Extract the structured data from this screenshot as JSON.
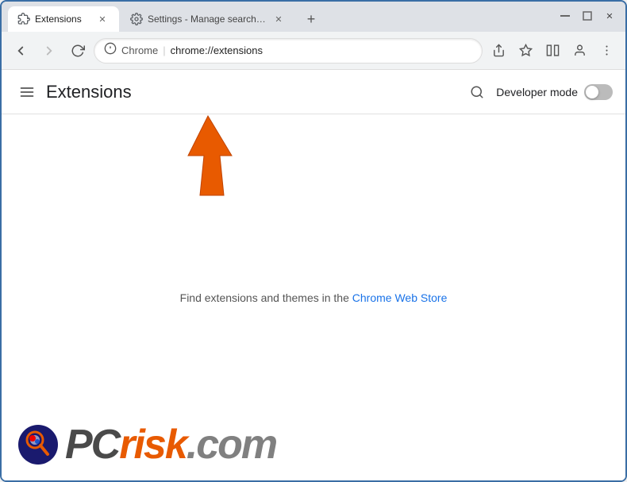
{
  "browser": {
    "tabs": [
      {
        "id": "tab-extensions",
        "label": "Extensions",
        "url": "chrome://extensions",
        "favicon": "puzzle",
        "active": true
      },
      {
        "id": "tab-settings",
        "label": "Settings - Manage search engine",
        "url": "chrome://settings/searchEngines",
        "favicon": "gear",
        "active": false
      }
    ],
    "new_tab_label": "+",
    "address_bar": {
      "site_name": "Chrome",
      "url": "chrome://extensions"
    },
    "window_controls": {
      "minimize": "—",
      "maximize": "□",
      "close": "✕"
    }
  },
  "nav": {
    "back_disabled": false,
    "forward_disabled": true
  },
  "extensions_page": {
    "title": "Extensions",
    "developer_mode_label": "Developer mode",
    "empty_state_text": "Find extensions and themes in the ",
    "chrome_web_store_label": "Chrome Web Store",
    "chrome_web_store_url": "https://chrome.google.com/webstore"
  },
  "watermark": {
    "text_pc": "PC",
    "text_risk": "risk",
    "text_dot_com": ".com"
  },
  "colors": {
    "accent_blue": "#1a73e8",
    "orange": "#e85a00",
    "dark_gray": "#4a4a4a",
    "mid_gray": "#808080"
  }
}
